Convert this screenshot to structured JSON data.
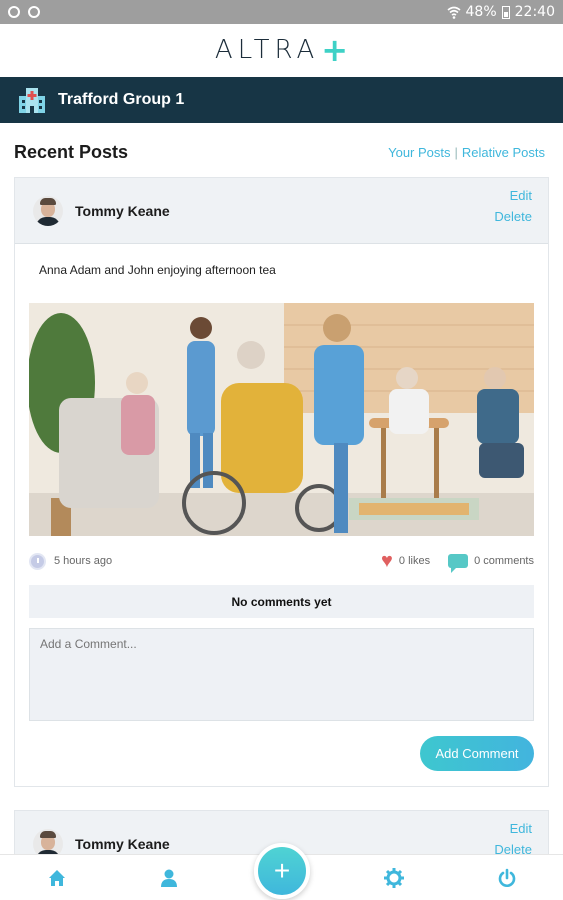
{
  "status_bar": {
    "battery": "48%",
    "time": "22:40"
  },
  "app": {
    "logo_text": "ALTRA",
    "logo_symbol": "+",
    "accent_color": "#3ed1c6"
  },
  "group": {
    "title": "Trafford Group 1",
    "icon": "hospital-icon"
  },
  "section": {
    "title": "Recent Posts",
    "link_your": "Your Posts",
    "separator": "|",
    "link_relative": "Relative Posts"
  },
  "posts": [
    {
      "author": "Tommy Keane",
      "edit_label": "Edit",
      "delete_label": "Delete",
      "text": "Anna Adam and John enjoying afternoon tea",
      "time": "5 hours ago",
      "likes": "0 likes",
      "comments": "0 comments",
      "no_comments": "No comments yet",
      "comment_placeholder": "Add a Comment...",
      "add_comment_label": "Add Comment"
    },
    {
      "author": "Tommy Keane",
      "edit_label": "Edit",
      "delete_label": "Delete"
    }
  ],
  "nav": {
    "fab_symbol": "+",
    "icons": [
      "home-icon",
      "profile-icon",
      "settings-icon",
      "power-icon"
    ]
  }
}
